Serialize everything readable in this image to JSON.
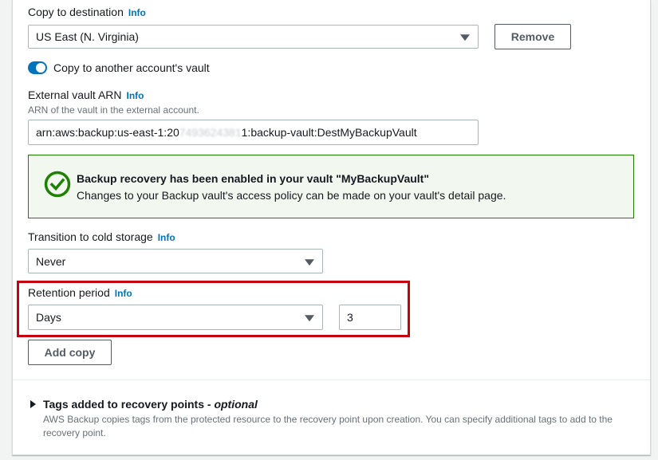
{
  "copy_destination": {
    "label": "Copy to destination",
    "info": "Info",
    "value": "US East (N. Virginia)",
    "remove_label": "Remove"
  },
  "copy_account_toggle": {
    "label": "Copy to another account's vault",
    "enabled": true
  },
  "external_vault": {
    "label": "External vault ARN",
    "info": "Info",
    "description": "ARN of the vault in the external account.",
    "value_prefix": "arn:aws:backup:us-east-1:20",
    "value_redacted": "7493624381",
    "value_suffix": "1:backup-vault:DestMyBackupVault"
  },
  "success_alert": {
    "title": "Backup recovery has been enabled in your vault \"MyBackupVault\"",
    "body": "Changes to your Backup vault's access policy can be made on your vault's detail page.",
    "color": "#1d8102"
  },
  "cold_storage": {
    "label": "Transition to cold storage",
    "info": "Info",
    "value": "Never"
  },
  "retention": {
    "label": "Retention period",
    "info": "Info",
    "unit_value": "Days",
    "amount_value": "3",
    "highlight_color": "#c7000d"
  },
  "add_copy_label": "Add copy",
  "tags_section": {
    "title": "Tags added to recovery points",
    "optional": "- optional",
    "description_line1": "AWS Backup copies tags from the protected resource to the recovery point upon creation. You can specify additional tags to add to the",
    "description_line2": "recovery point."
  }
}
